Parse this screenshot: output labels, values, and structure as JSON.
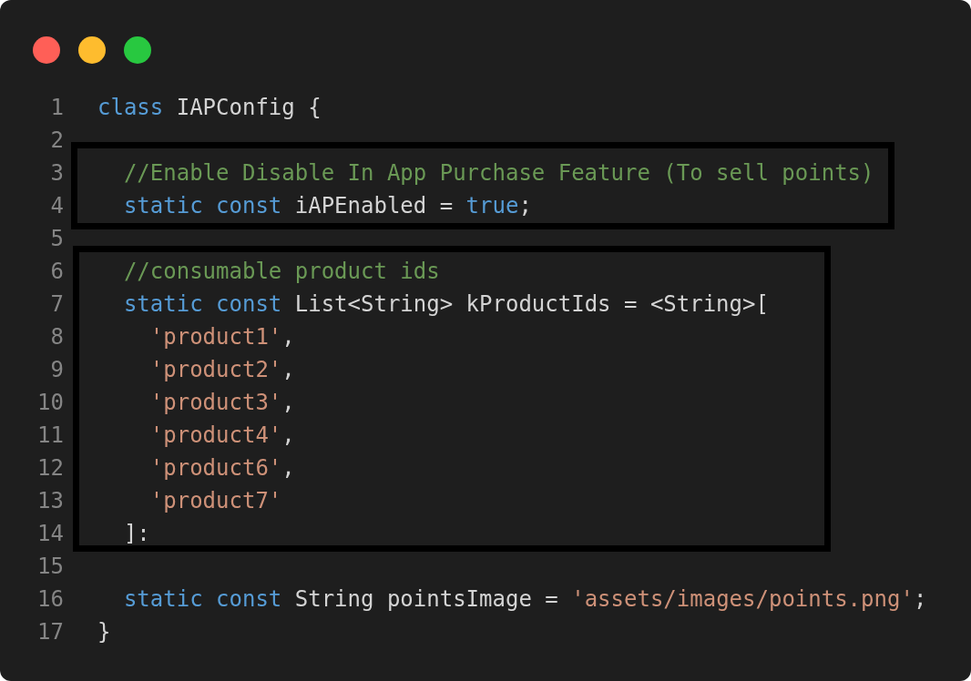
{
  "window_controls": [
    {
      "color": "#ff5f57"
    },
    {
      "color": "#febc2e"
    },
    {
      "color": "#28c840"
    }
  ],
  "code_blocks": [
    {
      "kind": "plain",
      "lines": [
        {
          "number": "1",
          "tokens": [
            {
              "kind": "keyword",
              "text": "class"
            },
            {
              "kind": "text",
              "text": " IAPConfig {"
            }
          ]
        },
        {
          "number": "2"
        }
      ]
    },
    {
      "kind": "framed",
      "lines": [
        {
          "number": "3",
          "tokens": [
            {
              "kind": "comment",
              "text": "  //Enable Disable In App Purchase Feature (To sell points)"
            }
          ]
        },
        {
          "number": "4",
          "tokens": [
            {
              "kind": "keyword",
              "text": "  static const"
            },
            {
              "kind": "text",
              "text": " iAPEnabled = "
            },
            {
              "kind": "keyword",
              "text": "true"
            },
            {
              "kind": "text",
              "text": ";"
            }
          ]
        }
      ]
    },
    {
      "kind": "plain",
      "lines": [
        {
          "number": "5"
        }
      ]
    },
    {
      "kind": "framed",
      "lines": [
        {
          "number": "6",
          "tokens": [
            {
              "kind": "comment",
              "text": "  //consumable product ids"
            }
          ]
        },
        {
          "number": "7",
          "tokens": [
            {
              "kind": "keyword",
              "text": "  static const"
            },
            {
              "kind": "text",
              "text": " List<String> kProductIds = <String>["
            }
          ]
        },
        {
          "number": "8",
          "tokens": [
            {
              "kind": "string",
              "text": "    'product1'"
            },
            {
              "kind": "text",
              "text": ","
            }
          ]
        },
        {
          "number": "9",
          "tokens": [
            {
              "kind": "string",
              "text": "    'product2'"
            },
            {
              "kind": "text",
              "text": ","
            }
          ]
        },
        {
          "number": "10",
          "tokens": [
            {
              "kind": "string",
              "text": "    'product3'"
            },
            {
              "kind": "text",
              "text": ","
            }
          ]
        },
        {
          "number": "11",
          "tokens": [
            {
              "kind": "string",
              "text": "    'product4'"
            },
            {
              "kind": "text",
              "text": ","
            }
          ]
        },
        {
          "number": "12",
          "tokens": [
            {
              "kind": "string",
              "text": "    'product6'"
            },
            {
              "kind": "text",
              "text": ","
            }
          ]
        },
        {
          "number": "13",
          "tokens": [
            {
              "kind": "string",
              "text": "    'product7'"
            }
          ]
        },
        {
          "number": "14",
          "tokens": [
            {
              "kind": "text",
              "text": "  ]:"
            }
          ]
        }
      ]
    },
    {
      "kind": "plain",
      "lines": [
        {
          "number": "15"
        },
        {
          "number": "16",
          "tokens": [
            {
              "kind": "keyword",
              "text": "  static const"
            },
            {
              "kind": "text",
              "text": " String pointsImage = "
            },
            {
              "kind": "string",
              "text": "'assets/images/points.png'"
            },
            {
              "kind": "text",
              "text": ";"
            }
          ]
        },
        {
          "number": "17",
          "tokens": [
            {
              "kind": "text",
              "text": "}"
            }
          ]
        }
      ]
    }
  ]
}
